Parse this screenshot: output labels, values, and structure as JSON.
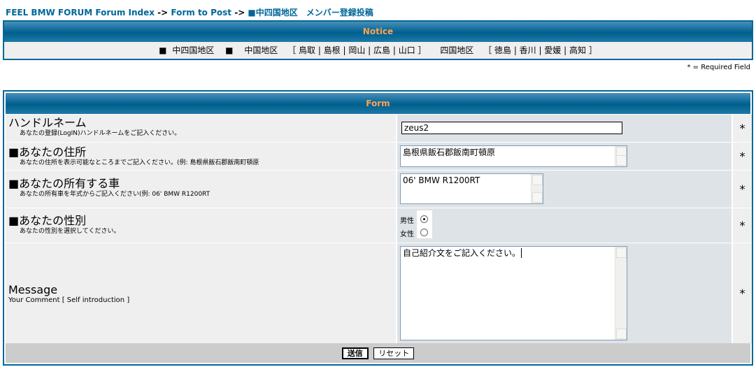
{
  "breadcrumb": {
    "index": "FEEL BMW FORUM Forum Index",
    "sep1": " -> ",
    "form_to_post": "Form to Post",
    "sep2": " -> ",
    "current": "■中四国地区　メンバー登録投稿"
  },
  "notice": {
    "title": "Notice",
    "regions": [
      "■",
      "中四国地区",
      "■",
      "中国地区",
      "［ 鳥取 | 島根 | 岡山 | 広島 | 山口 ］",
      "四国地区",
      "［ 徳島 | 香川 | 愛媛 | 高知 ］"
    ]
  },
  "required_note": "* = Required Field",
  "form": {
    "title": "Form",
    "required_mark": "*",
    "handle": {
      "label": "ハンドルネーム",
      "hint": "あなたの登録(LogIN)ハンドルネームをご記入ください。",
      "value": "zeus2"
    },
    "address": {
      "label": "■あなたの住所",
      "hint": "あなたの住所を表示可能なところまでご記入ください。(例: 島根県飯石郡飯南町頓原",
      "value": "島根県飯石郡飯南町頓原"
    },
    "car": {
      "label": "■あなたの所有する車",
      "hint": "あなたの所有車を年式からご記入ください(例: 06' BMW R1200RT",
      "value": "06' BMW R1200RT"
    },
    "gender": {
      "label": "■あなたの性別",
      "hint": "あなたの性別を選択してください。",
      "options": [
        "男性",
        "女性"
      ],
      "selected": "男性"
    },
    "message": {
      "label": "Message",
      "hint": "Your Comment [ Self introduction ]",
      "value": "自己紹介文をご記入ください。"
    },
    "submit_label": "送信",
    "reset_label": "リセット"
  }
}
